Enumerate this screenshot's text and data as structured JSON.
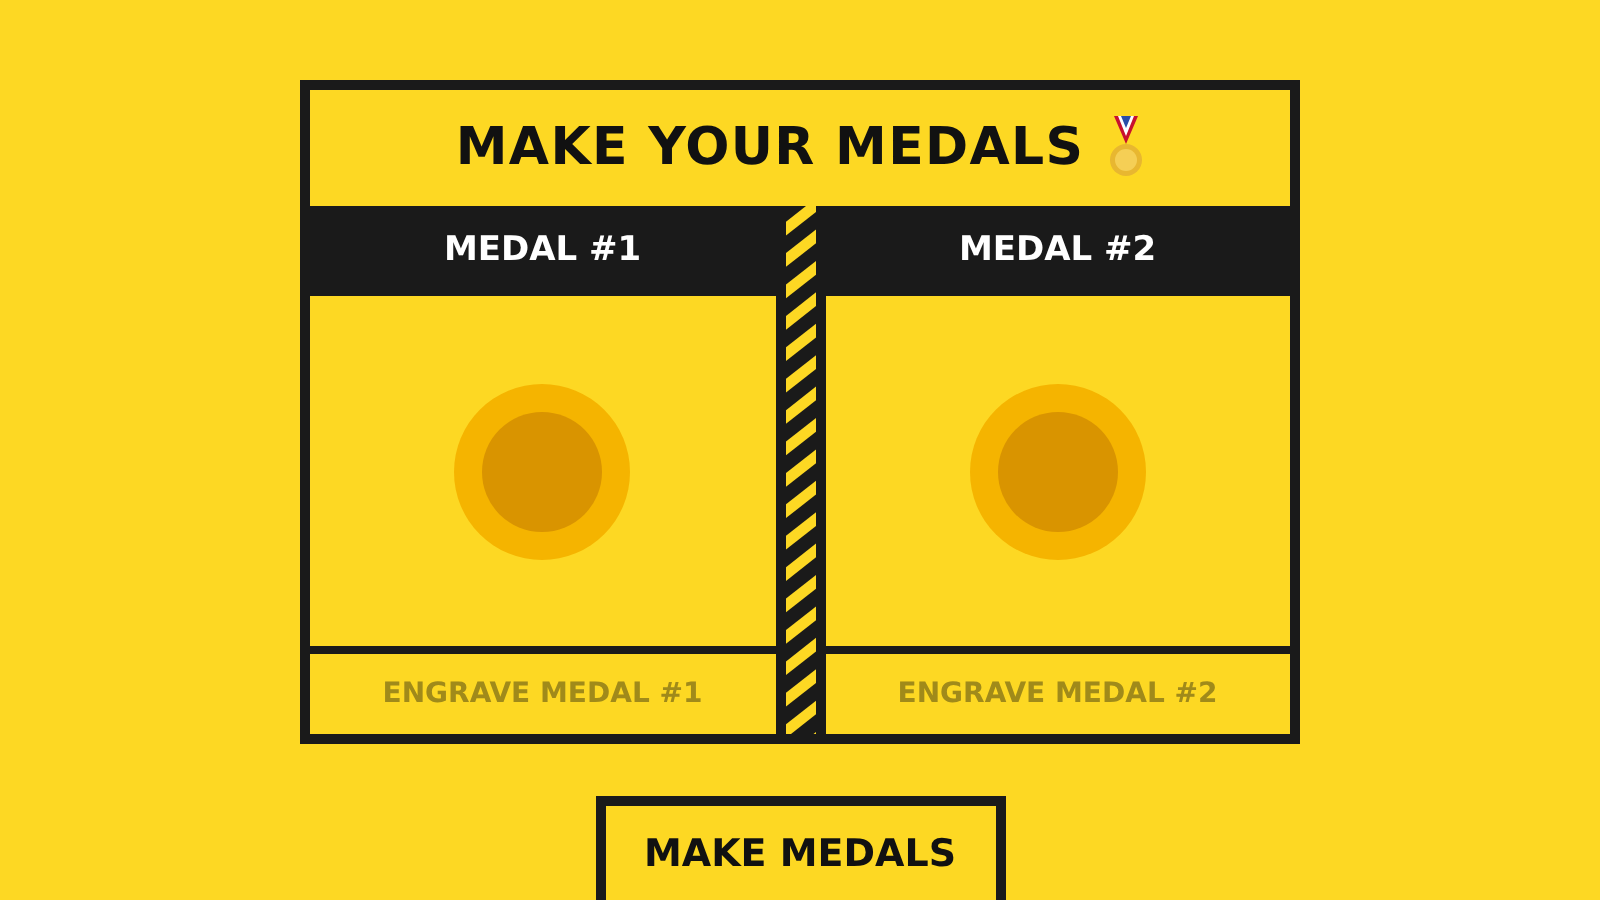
{
  "title": "MAKE YOUR MEDALS",
  "medals": [
    {
      "heading": "MEDAL #1",
      "engrave": {
        "placeholder": "ENGRAVE MEDAL #1"
      }
    },
    {
      "heading": "MEDAL #2",
      "engrave": {
        "placeholder": "ENGRAVE MEDAL #2"
      }
    }
  ],
  "button": "MAKE MEDALS"
}
